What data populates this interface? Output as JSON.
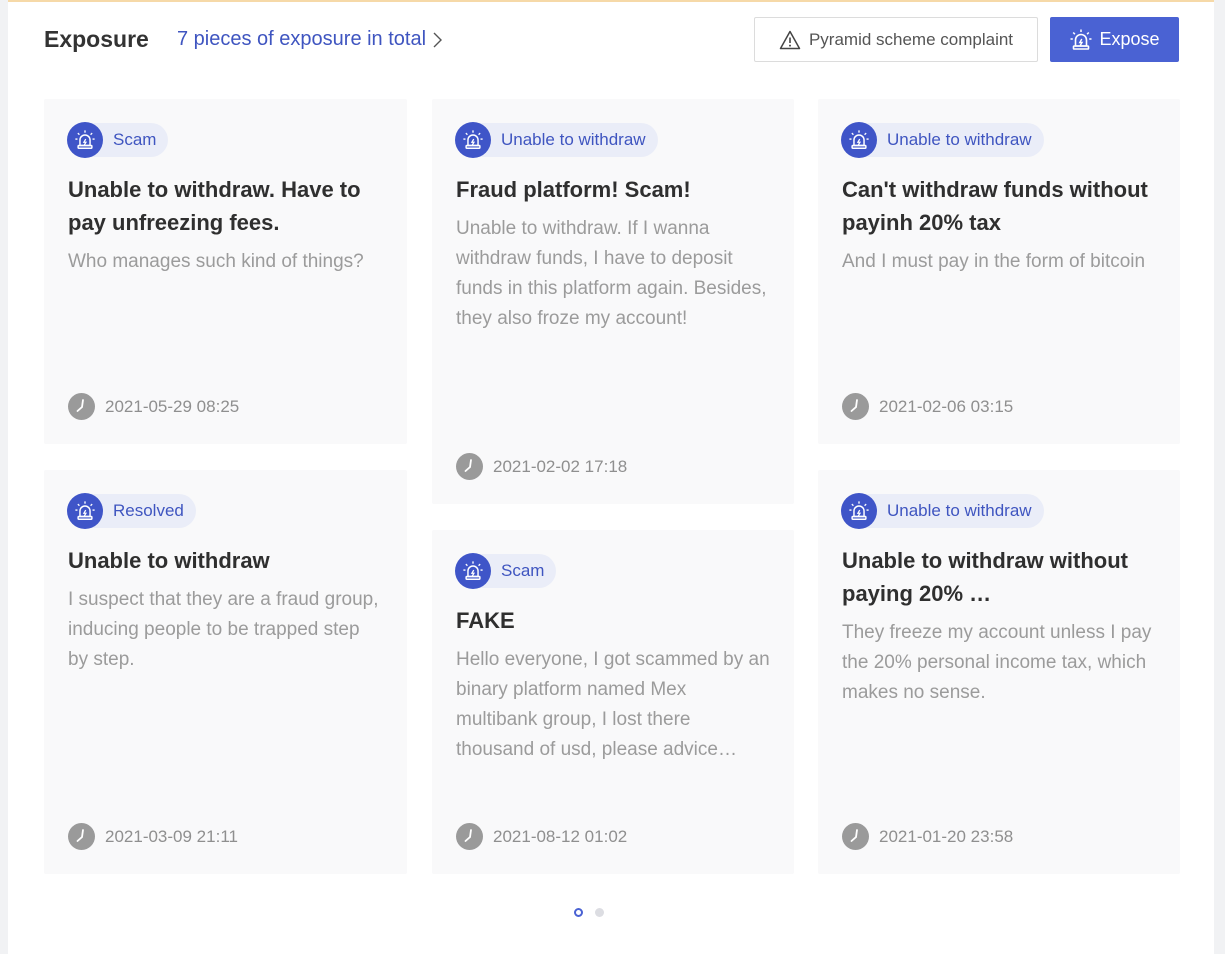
{
  "header": {
    "title": "Exposure",
    "total_link": "7 pieces of exposure in total",
    "complaint_label": "Pyramid scheme complaint",
    "expose_label": "Expose"
  },
  "colors": {
    "accent": "#4a62d3",
    "tag_bg": "#eaedf8",
    "card_bg": "#f9f9fa"
  },
  "icons": {
    "tag": "alarm-siren-icon",
    "time": "clock-icon",
    "complaint": "warning-triangle-icon",
    "link": "chevron-right-icon"
  },
  "cards": [
    {
      "tag": "Scam",
      "title": "Unable to withdraw. Have to pay unfreezing fees.",
      "desc": "Who manages such kind of things?",
      "time": "2021-05-29 08:25"
    },
    {
      "tag": "Unable to withdraw",
      "title": "Fraud platform! Scam!",
      "desc": "Unable to withdraw. If I wanna withdraw funds, I have to deposit funds in this platform again. Besides, they also froze my account!",
      "time": "2021-02-02 17:18"
    },
    {
      "tag": "Unable to withdraw",
      "title": "Can't withdraw funds without payinh 20% tax",
      "desc": "And I must pay in the form of bitcoin",
      "time": "2021-02-06 03:15"
    },
    {
      "tag": "Resolved",
      "title": "Unable to withdraw",
      "desc": "I suspect that they are a fraud group, inducing people to be trapped step by step.",
      "time": "2021-03-09 21:11"
    },
    {
      "tag": "Scam",
      "title": "FAKE",
      "desc": "Hello everyone, I got scammed by an binary platform named Mex multibank group, I lost there thousand of usd, please advice…",
      "time": "2021-08-12 01:02"
    },
    {
      "tag": "Unable to withdraw",
      "title": "Unable to withdraw without paying 20% …",
      "desc": "They freeze my account unless I pay the 20% personal income tax, which makes no sense.",
      "time": "2021-01-20 23:58"
    }
  ],
  "pagination": {
    "pages": 2,
    "current": 1
  }
}
